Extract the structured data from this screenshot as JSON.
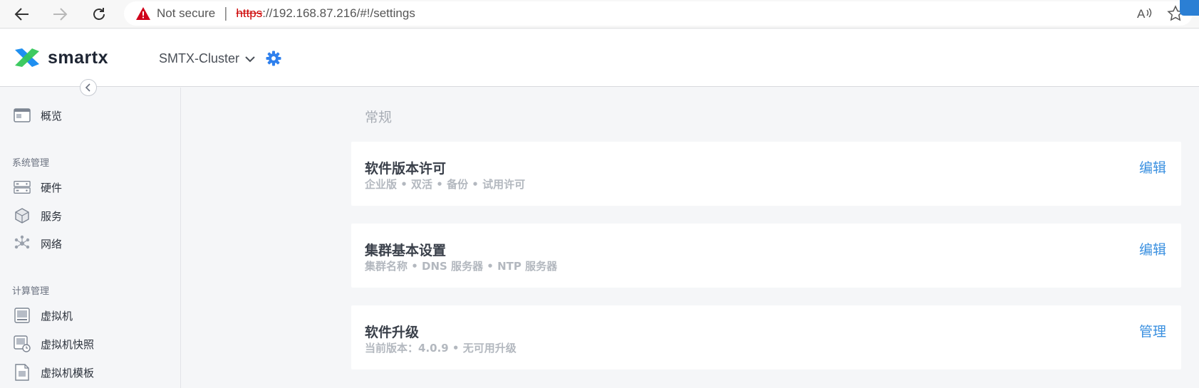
{
  "browser": {
    "not_secure": "Not secure",
    "scheme": "https",
    "url_rest": "://192.168.87.216/#!/settings"
  },
  "header": {
    "brand": "smartx",
    "cluster": "SMTX-Cluster"
  },
  "sidebar": {
    "overview": "概览",
    "groups": [
      {
        "title": "系统管理",
        "items": [
          "硬件",
          "服务",
          "网络"
        ]
      },
      {
        "title": "计算管理",
        "items": [
          "虚拟机",
          "虚拟机快照",
          "虚拟机模板"
        ]
      }
    ]
  },
  "main": {
    "section_title": "常规",
    "cards": [
      {
        "title": "软件版本许可",
        "subtitle": "企业版 • 双活 • 备份 • 试用许可",
        "action": "编辑"
      },
      {
        "title": "集群基本设置",
        "subtitle": "集群名称 • DNS 服务器 • NTP 服务器",
        "action": "编辑"
      },
      {
        "title": "软件升级",
        "subtitle": "当前版本：4.0.9 • 无可用升级",
        "action": "管理"
      }
    ]
  },
  "colors": {
    "accent": "#3a90e0",
    "brand_blue": "#1f8ff0",
    "brand_green": "#34c759",
    "warning_red": "#d0021b"
  },
  "icons": [
    "back-arrow-icon",
    "forward-arrow-icon",
    "reload-icon",
    "warning-icon",
    "read-aloud-icon",
    "favorite-star-icon",
    "chevron-down-icon",
    "gear-icon",
    "chevron-left-icon",
    "overview-icon",
    "hardware-icon",
    "service-icon",
    "network-icon",
    "vm-icon",
    "vm-snapshot-icon",
    "vm-template-icon"
  ]
}
